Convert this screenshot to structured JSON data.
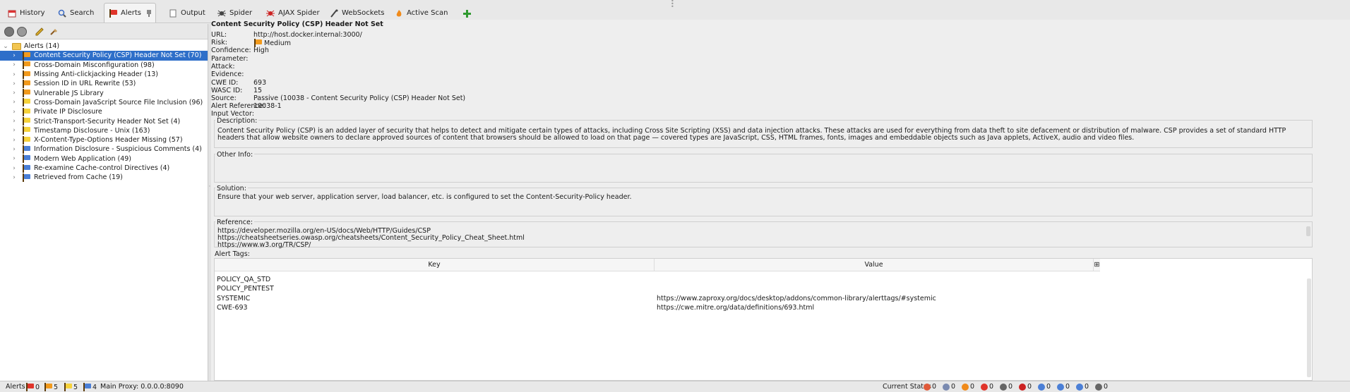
{
  "tabs": [
    {
      "label": "History",
      "icon": "history-icon"
    },
    {
      "label": "Search",
      "icon": "search-icon"
    },
    {
      "label": "Alerts",
      "icon": "alert-flag-icon"
    },
    {
      "label": "Output",
      "icon": "output-icon"
    },
    {
      "label": "Spider",
      "icon": "spider-icon"
    },
    {
      "label": "AJAX Spider",
      "icon": "ajax-spider-icon"
    },
    {
      "label": "WebSockets",
      "icon": "websockets-icon"
    },
    {
      "label": "Active Scan",
      "icon": "active-scan-icon"
    }
  ],
  "tree": {
    "root": "Alerts (14)",
    "items": [
      {
        "label": "Content Security Policy (CSP) Header Not Set (70)",
        "risk": "orange"
      },
      {
        "label": "Cross-Domain Misconfiguration (98)",
        "risk": "orange"
      },
      {
        "label": "Missing Anti-clickjacking Header (13)",
        "risk": "orange"
      },
      {
        "label": "Session ID in URL Rewrite (53)",
        "risk": "orange"
      },
      {
        "label": "Vulnerable JS Library",
        "risk": "orange"
      },
      {
        "label": "Cross-Domain JavaScript Source File Inclusion (96)",
        "risk": "yellow"
      },
      {
        "label": "Private IP Disclosure",
        "risk": "yellow"
      },
      {
        "label": "Strict-Transport-Security Header Not Set (4)",
        "risk": "yellow"
      },
      {
        "label": "Timestamp Disclosure - Unix (163)",
        "risk": "yellow"
      },
      {
        "label": "X-Content-Type-Options Header Missing (57)",
        "risk": "yellow"
      },
      {
        "label": "Information Disclosure - Suspicious Comments (4)",
        "risk": "blue"
      },
      {
        "label": "Modern Web Application (49)",
        "risk": "blue"
      },
      {
        "label": "Re-examine Cache-control Directives (4)",
        "risk": "blue"
      },
      {
        "label": "Retrieved from Cache (19)",
        "risk": "blue"
      }
    ]
  },
  "detail": {
    "title": "Content Security Policy (CSP) Header Not Set",
    "fields": [
      {
        "k": "URL:",
        "v": "http://host.docker.internal:3000/"
      },
      {
        "k": "Risk:",
        "v": "Medium"
      },
      {
        "k": "Confidence:",
        "v": "High"
      },
      {
        "k": "Parameter:",
        "v": ""
      },
      {
        "k": "Attack:",
        "v": ""
      },
      {
        "k": "Evidence:",
        "v": ""
      },
      {
        "k": "CWE ID:",
        "v": "693"
      },
      {
        "k": "WASC ID:",
        "v": "15"
      },
      {
        "k": "Source:",
        "v": "Passive (10038 - Content Security Policy (CSP) Header Not Set)"
      },
      {
        "k": "Alert Reference:",
        "v": "10038-1"
      },
      {
        "k": "Input Vector:",
        "v": ""
      }
    ],
    "description_label": "Description:",
    "description": "Content Security Policy (CSP) is an added layer of security that helps to detect and mitigate certain types of attacks, including Cross Site Scripting (XSS) and data injection attacks. These attacks are used for everything from data theft to site defacement or distribution of malware. CSP provides a set of standard HTTP headers that allow website owners to declare approved sources of content that browsers should be allowed to load on that page — covered types are JavaScript, CSS, HTML frames, fonts, images and embeddable objects such as Java applets, ActiveX, audio and video files.",
    "other_label": "Other Info:",
    "other": "",
    "solution_label": "Solution:",
    "solution": "Ensure that your web server, application server, load balancer, etc. is configured to set the Content-Security-Policy header.",
    "reference_label": "Reference:",
    "references": [
      "https://developer.mozilla.org/en-US/docs/Web/HTTP/Guides/CSP",
      "https://cheatsheetseries.owasp.org/cheatsheets/Content_Security_Policy_Cheat_Sheet.html",
      "https://www.w3.org/TR/CSP/"
    ],
    "tags_label": "Alert Tags:",
    "tags_headers": {
      "key": "Key",
      "value": "Value"
    },
    "tags": [
      {
        "key": "POLICY_QA_STD",
        "value": ""
      },
      {
        "key": "POLICY_PENTEST",
        "value": ""
      },
      {
        "key": "SYSTEMIC",
        "value": "https://www.zaproxy.org/docs/desktop/addons/common-library/alerttags/#systemic"
      },
      {
        "key": "CWE-693",
        "value": "https://cwe.mitre.org/data/definitions/693.html"
      }
    ]
  },
  "status": {
    "alerts_label": "Alerts",
    "high": "0",
    "medium": "5",
    "low": "5",
    "info": "4",
    "proxy": "Main Proxy: 0.0.0.0:8090",
    "current_status": "Current Status",
    "counts": [
      "0",
      "0",
      "0",
      "0",
      "0",
      "0",
      "0",
      "0",
      "0",
      "0"
    ]
  }
}
